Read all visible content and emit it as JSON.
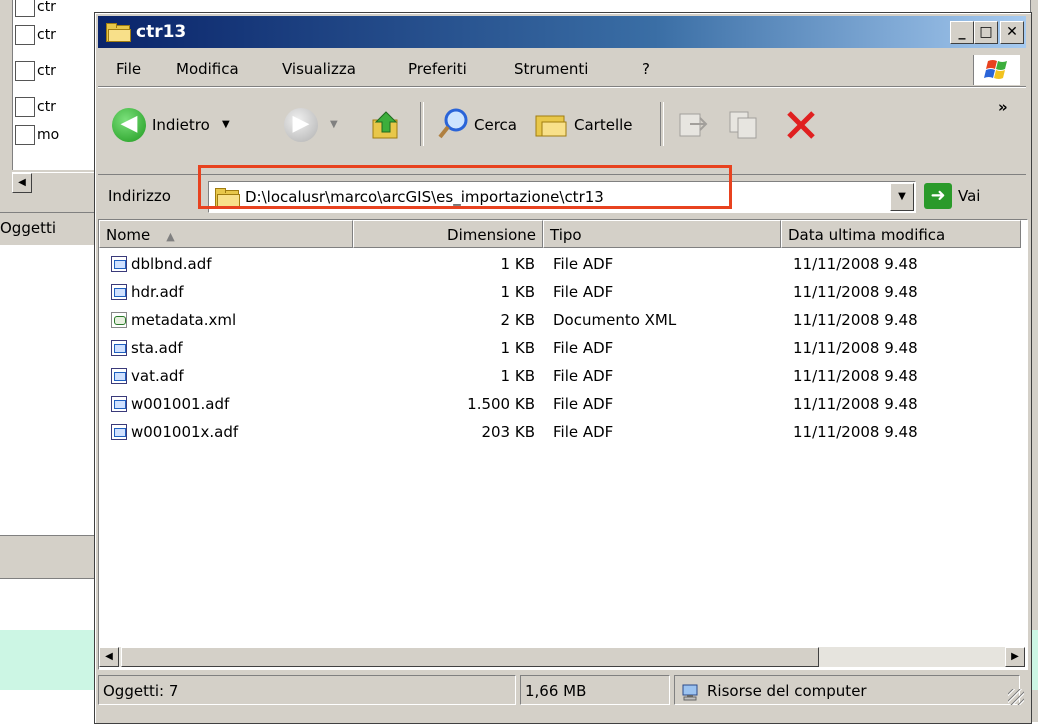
{
  "background_window": {
    "rows": [
      {
        "label": "ctr",
        "icon": "shp-file-icon"
      },
      {
        "label": "ctr",
        "icon": "xml-file-icon"
      },
      {
        "label": "ctr",
        "icon": "shx-file-icon"
      },
      {
        "label": "mo",
        "icon": "mxd-file-icon"
      }
    ],
    "status": "Oggetti"
  },
  "window": {
    "title": "ctr13",
    "caption_buttons": {
      "minimize": "_",
      "maximize": "□",
      "close": "✕"
    }
  },
  "menu": [
    "File",
    "Modifica",
    "Visualizza",
    "Preferiti",
    "Strumenti",
    "?"
  ],
  "toolbar": {
    "back_label": "Indietro",
    "search_label": "Cerca",
    "folders_label": "Cartelle",
    "more": "»"
  },
  "address": {
    "label": "Indirizzo",
    "value": "D:\\localusr\\marco\\arcGIS\\es_importazione\\ctr13",
    "go_label": "Vai"
  },
  "columns": [
    "Nome",
    "Dimensione",
    "Tipo",
    "Data ultima modifica"
  ],
  "files": [
    {
      "name": "dblbnd.adf",
      "size": "1 KB",
      "type": "File ADF",
      "modified": "11/11/2008 9.48",
      "icon": "adf-file-icon"
    },
    {
      "name": "hdr.adf",
      "size": "1 KB",
      "type": "File ADF",
      "modified": "11/11/2008 9.48",
      "icon": "adf-file-icon"
    },
    {
      "name": "metadata.xml",
      "size": "2 KB",
      "type": "Documento XML",
      "modified": "11/11/2008 9.48",
      "icon": "xml-file-icon"
    },
    {
      "name": "sta.adf",
      "size": "1 KB",
      "type": "File ADF",
      "modified": "11/11/2008 9.48",
      "icon": "adf-file-icon"
    },
    {
      "name": "vat.adf",
      "size": "1 KB",
      "type": "File ADF",
      "modified": "11/11/2008 9.48",
      "icon": "adf-file-icon"
    },
    {
      "name": "w001001.adf",
      "size": "1.500 KB",
      "type": "File ADF",
      "modified": "11/11/2008 9.48",
      "icon": "adf-file-icon"
    },
    {
      "name": "w001001x.adf",
      "size": "203 KB",
      "type": "File ADF",
      "modified": "11/11/2008 9.48",
      "icon": "adf-file-icon"
    }
  ],
  "status": {
    "objects": "Oggetti: 7",
    "size": "1,66 MB",
    "location": "Risorse del computer"
  },
  "colors": {
    "title_bar": "#0a246a",
    "highlight": "#e8421f",
    "window_face": "#d4d0c8"
  }
}
